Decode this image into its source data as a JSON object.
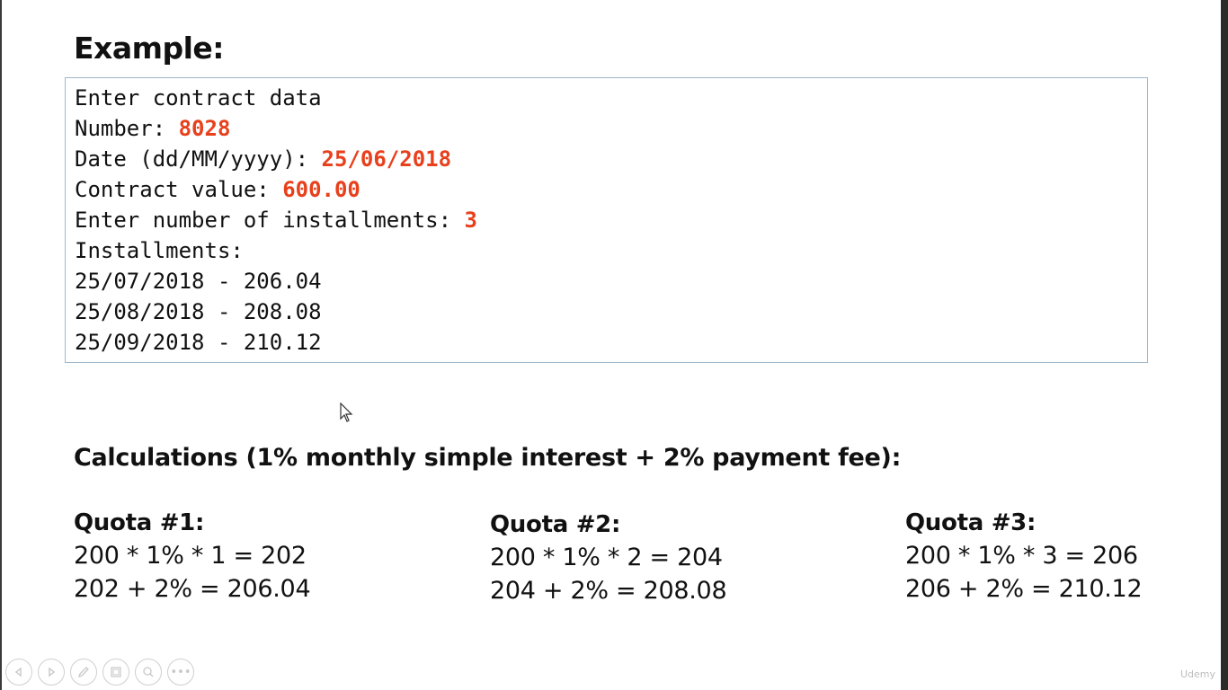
{
  "slide": {
    "title": "Example:",
    "console": {
      "header": "Enter contract data",
      "number_label": "Number: ",
      "number_value": "8028",
      "date_label": "Date (dd/MM/yyyy): ",
      "date_value": "25/06/2018",
      "value_label": "Contract value: ",
      "value_value": "600.00",
      "installments_prompt": "Enter number of installments: ",
      "installments_value": "3",
      "installments_header": "Installments:",
      "installments": [
        "25/07/2018 - 206.04",
        "25/08/2018 - 208.08",
        "25/09/2018 - 210.12"
      ]
    },
    "calc_title": "Calculations (1% monthly simple interest + 2% payment fee):",
    "quotas": [
      {
        "title": "Quota #1:",
        "line1": "200 * 1% * 1 = 202",
        "line2": "202 + 2% = 206.04"
      },
      {
        "title": "Quota #2:",
        "line1": "200 * 1% * 2 = 204",
        "line2": "204 + 2% = 208.08"
      },
      {
        "title": "Quota #3:",
        "line1": "200 * 1% * 3 = 206",
        "line2": "206 + 2% = 210.12"
      }
    ]
  },
  "player": {
    "controls": [
      "previous-icon",
      "next-icon",
      "pen-icon",
      "slides-icon",
      "zoom-icon",
      "more-icon"
    ],
    "more_label": "•••",
    "watermark": "Udemy"
  },
  "colors": {
    "highlight": "#e8401c",
    "console_border": "#9fb7c9"
  }
}
